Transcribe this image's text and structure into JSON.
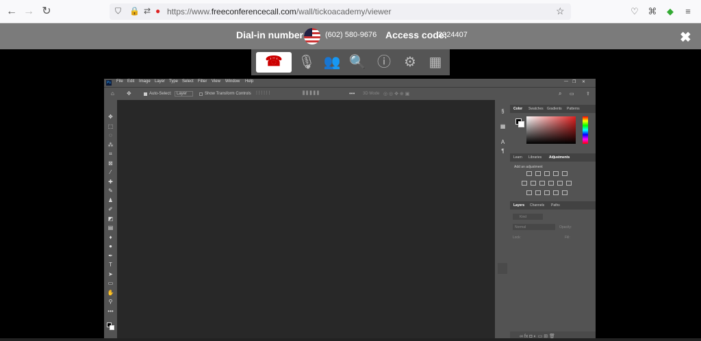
{
  "browser": {
    "url_prefix": "https://www.",
    "url_host": "freeconferencecall.com",
    "url_path": "/wall/tickoacademy/viewer"
  },
  "info_bar": {
    "dial_label": "Dial-in number:",
    "dial_number": "(602) 580-9676",
    "access_label": "Access code:",
    "access_code": "2324407"
  },
  "photoshop": {
    "menu": [
      "File",
      "Edit",
      "Image",
      "Layer",
      "Type",
      "Select",
      "Filter",
      "View",
      "Window",
      "Help"
    ],
    "options": {
      "auto_select": "Auto-Select:",
      "layer": "Layer",
      "show_transform": "Show Transform Controls"
    },
    "color_tabs": [
      "Color",
      "Swatches",
      "Gradients",
      "Patterns"
    ],
    "learn_tabs": [
      "Learn",
      "Libraries",
      "Adjustments"
    ],
    "add_adjustment": "Add an adjustment",
    "layers_tabs": [
      "Layers",
      "Channels",
      "Paths"
    ],
    "kind": "Kind",
    "normal": "Normal",
    "opacity": "Opacity:",
    "lock": "Lock:",
    "fill": "Fill:"
  }
}
